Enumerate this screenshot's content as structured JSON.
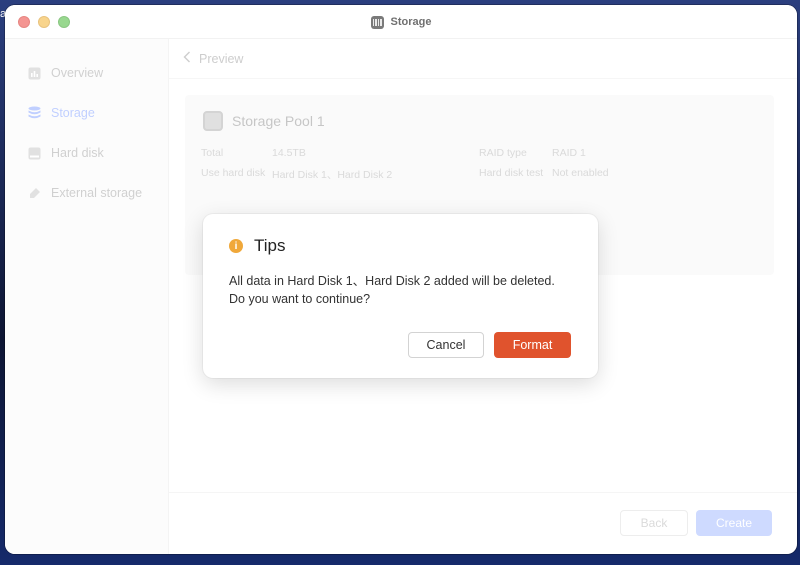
{
  "window": {
    "title": "Storage"
  },
  "sidebar": {
    "items": [
      {
        "label": "Overview",
        "icon": "overview-icon"
      },
      {
        "label": "Storage",
        "icon": "storage-icon",
        "active": true
      },
      {
        "label": "Hard disk",
        "icon": "hard-disk-icon"
      },
      {
        "label": "External storage",
        "icon": "external-storage-icon"
      }
    ]
  },
  "main": {
    "back_label": "Preview",
    "pool": {
      "title": "Storage Pool 1",
      "total_label": "Total",
      "total_value": "14.5TB",
      "use_label": "Use hard disk",
      "use_value": "Hard Disk 1、Hard Disk 2",
      "raid_label": "RAID type",
      "raid_value": "RAID 1",
      "test_label": "Hard disk test",
      "test_value": "Not enabled"
    },
    "footer": {
      "back_label": "Back",
      "create_label": "Create"
    }
  },
  "dialog": {
    "title": "Tips",
    "icon": "info-icon",
    "message": "All data in Hard Disk 1、Hard Disk 2 added will be deleted. Do you want to continue?",
    "cancel_label": "Cancel",
    "format_label": "Format"
  },
  "colors": {
    "accent": "#9fb6ff",
    "danger": "#e0532d",
    "warning": "#f0a83a"
  }
}
